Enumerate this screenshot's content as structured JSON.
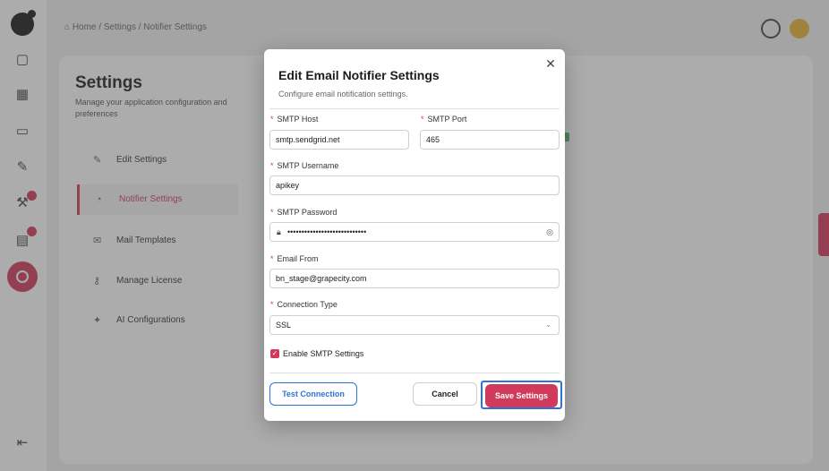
{
  "background": {
    "breadcrumb": "⌂ Home / Settings / Notifier Settings",
    "settings_title": "Settings",
    "settings_subtitle": "Manage your application configuration and preferences",
    "menu": [
      {
        "label": "Edit Settings",
        "icon": "edit-icon"
      },
      {
        "label": "Notifier Settings",
        "icon": "bell-icon"
      },
      {
        "label": "Mail Templates",
        "icon": "mail-icon"
      },
      {
        "label": "Manage License",
        "icon": "key-icon"
      },
      {
        "label": "AI Configurations",
        "icon": "ai-icon"
      }
    ]
  },
  "modal": {
    "title": "Edit Email Notifier Settings",
    "subtitle": "Configure email notification settings.",
    "close_glyph": "✕",
    "fields": {
      "smtp_host": {
        "label": "SMTP Host",
        "value": "smtp.sendgrid.net"
      },
      "smtp_port": {
        "label": "SMTP Port",
        "value": "465"
      },
      "smtp_username": {
        "label": "SMTP Username",
        "value": "apikey"
      },
      "smtp_password": {
        "label": "SMTP Password",
        "value": "••••••••••••••••••••••••••••"
      },
      "email_from": {
        "label": "Email From",
        "value": "bn_stage@grapecity.com"
      },
      "connection_type": {
        "label": "Connection Type",
        "value": "SSL"
      }
    },
    "required_marker": "*",
    "enable_smtp": {
      "label": "Enable SMTP Settings",
      "checked": true
    },
    "buttons": {
      "test": "Test Connection",
      "cancel": "Cancel",
      "save": "Save Settings"
    }
  },
  "colors": {
    "accent": "#d23a5b",
    "link_blue": "#2f72d8"
  }
}
